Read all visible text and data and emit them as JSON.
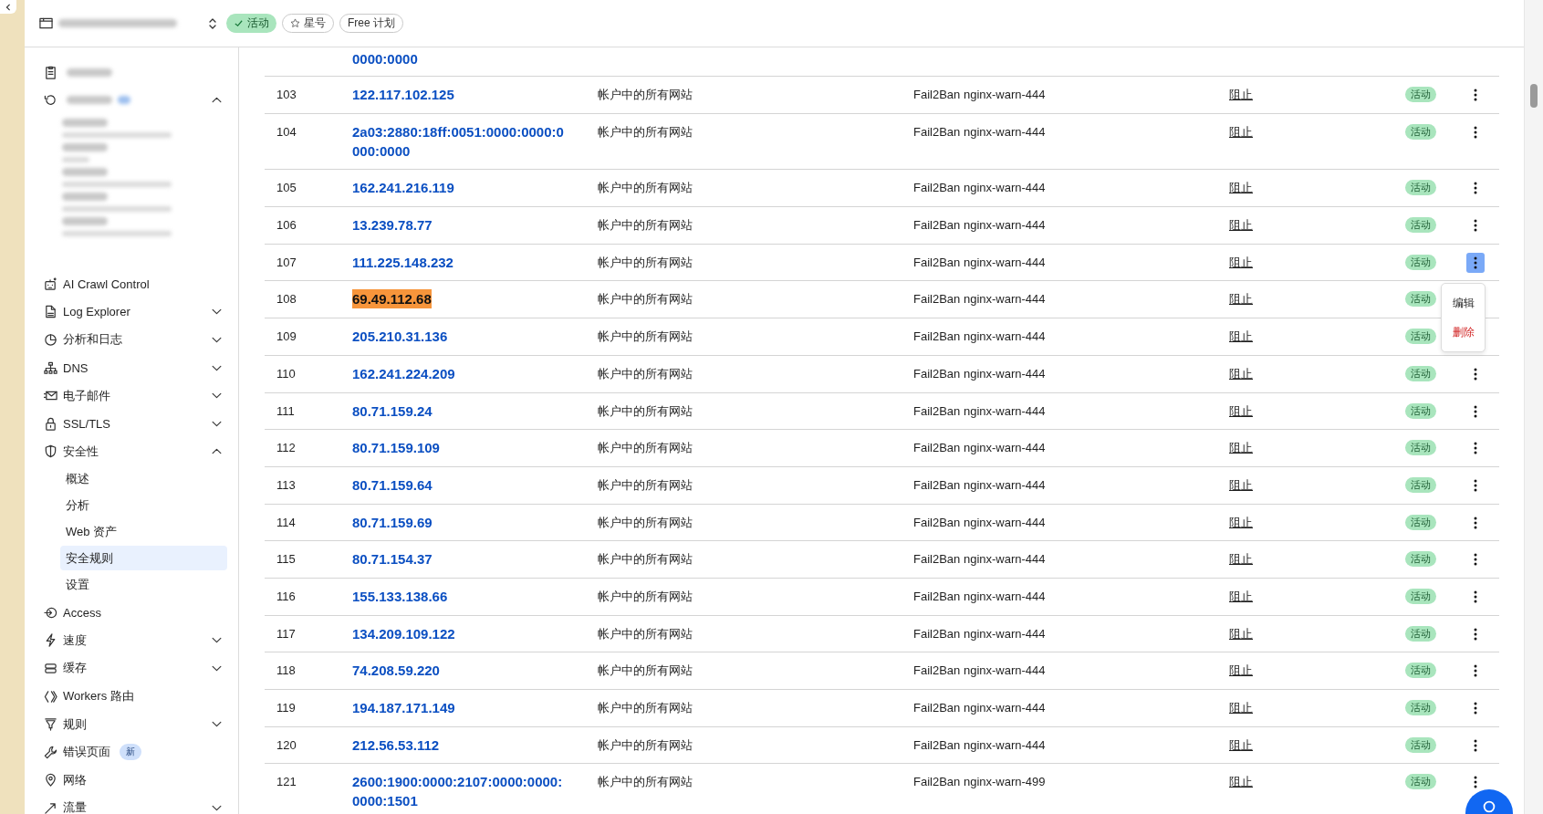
{
  "header": {
    "status_badge": "活动",
    "star_button": "星号",
    "plan_badge": "Free 计划"
  },
  "sidebar": {
    "redacted_section": {
      "expanded": true
    },
    "items": [
      {
        "label": "AI Crawl Control"
      },
      {
        "label": "Log Explorer",
        "expanded": false
      },
      {
        "label": "分析和日志",
        "expanded": false
      },
      {
        "label": "DNS",
        "expanded": false
      },
      {
        "label": "电子邮件",
        "expanded": false
      },
      {
        "label": "SSL/TLS",
        "expanded": false
      },
      {
        "label": "安全性",
        "expanded": true,
        "children": [
          {
            "label": "概述",
            "selected": false
          },
          {
            "label": "分析",
            "selected": false
          },
          {
            "label": "Web 资产",
            "selected": false
          },
          {
            "label": "安全规则",
            "selected": true
          },
          {
            "label": "设置",
            "selected": false
          }
        ]
      },
      {
        "label": "Access"
      },
      {
        "label": "速度",
        "expanded": false
      },
      {
        "label": "缓存",
        "expanded": false
      },
      {
        "label": "Workers 路由"
      },
      {
        "label": "规则",
        "expanded": false
      },
      {
        "label": "错误页面",
        "badge": "新"
      },
      {
        "label": "网络"
      },
      {
        "label": "流量",
        "expanded": false
      }
    ]
  },
  "table": {
    "rows": [
      {
        "ip": "0000:0000"
      },
      {
        "number": "103",
        "ip": "122.117.102.125",
        "scope": "帐户中的所有网站",
        "rule": "Fail2Ban nginx-warn-444",
        "action": "阻止",
        "status": "活动",
        "highlighted": false,
        "menu_open": false
      },
      {
        "number": "104",
        "ip": "2a03:2880:18ff:0051:0000:0000:0000:0000",
        "scope": "帐户中的所有网站",
        "rule": "Fail2Ban nginx-warn-444",
        "action": "阻止",
        "status": "活动",
        "highlighted": false,
        "menu_open": false
      },
      {
        "number": "105",
        "ip": "162.241.216.119",
        "scope": "帐户中的所有网站",
        "rule": "Fail2Ban nginx-warn-444",
        "action": "阻止",
        "status": "活动",
        "highlighted": false,
        "menu_open": false
      },
      {
        "number": "106",
        "ip": "13.239.78.77",
        "scope": "帐户中的所有网站",
        "rule": "Fail2Ban nginx-warn-444",
        "action": "阻止",
        "status": "活动",
        "highlighted": false,
        "menu_open": false
      },
      {
        "number": "107",
        "ip": "111.225.148.232",
        "scope": "帐户中的所有网站",
        "rule": "Fail2Ban nginx-warn-444",
        "action": "阻止",
        "status": "活动",
        "highlighted": false,
        "menu_open": true
      },
      {
        "number": "108",
        "ip": "69.49.112.68",
        "scope": "帐户中的所有网站",
        "rule": "Fail2Ban nginx-warn-444",
        "action": "阻止",
        "status": "活动",
        "highlighted": true
      },
      {
        "number": "109",
        "ip": "205.210.31.136",
        "scope": "帐户中的所有网站",
        "rule": "Fail2Ban nginx-warn-444",
        "action": "阻止",
        "status": "活动",
        "highlighted": false
      },
      {
        "number": "110",
        "ip": "162.241.224.209",
        "scope": "帐户中的所有网站",
        "rule": "Fail2Ban nginx-warn-444",
        "action": "阻止",
        "status": "活动",
        "highlighted": false,
        "menu_open": false
      },
      {
        "number": "111",
        "ip": "80.71.159.24",
        "scope": "帐户中的所有网站",
        "rule": "Fail2Ban nginx-warn-444",
        "action": "阻止",
        "status": "活动",
        "highlighted": false,
        "menu_open": false
      },
      {
        "number": "112",
        "ip": "80.71.159.109",
        "scope": "帐户中的所有网站",
        "rule": "Fail2Ban nginx-warn-444",
        "action": "阻止",
        "status": "活动",
        "highlighted": false,
        "menu_open": false
      },
      {
        "number": "113",
        "ip": "80.71.159.64",
        "scope": "帐户中的所有网站",
        "rule": "Fail2Ban nginx-warn-444",
        "action": "阻止",
        "status": "活动",
        "highlighted": false,
        "menu_open": false
      },
      {
        "number": "114",
        "ip": "80.71.159.69",
        "scope": "帐户中的所有网站",
        "rule": "Fail2Ban nginx-warn-444",
        "action": "阻止",
        "status": "活动",
        "highlighted": false,
        "menu_open": false
      },
      {
        "number": "115",
        "ip": "80.71.154.37",
        "scope": "帐户中的所有网站",
        "rule": "Fail2Ban nginx-warn-444",
        "action": "阻止",
        "status": "活动",
        "highlighted": false,
        "menu_open": false
      },
      {
        "number": "116",
        "ip": "155.133.138.66",
        "scope": "帐户中的所有网站",
        "rule": "Fail2Ban nginx-warn-444",
        "action": "阻止",
        "status": "活动",
        "highlighted": false,
        "menu_open": false
      },
      {
        "number": "117",
        "ip": "134.209.109.122",
        "scope": "帐户中的所有网站",
        "rule": "Fail2Ban nginx-warn-444",
        "action": "阻止",
        "status": "活动",
        "highlighted": false,
        "menu_open": false
      },
      {
        "number": "118",
        "ip": "74.208.59.220",
        "scope": "帐户中的所有网站",
        "rule": "Fail2Ban nginx-warn-444",
        "action": "阻止",
        "status": "活动",
        "highlighted": false,
        "menu_open": false
      },
      {
        "number": "119",
        "ip": "194.187.171.149",
        "scope": "帐户中的所有网站",
        "rule": "Fail2Ban nginx-warn-444",
        "action": "阻止",
        "status": "活动",
        "highlighted": false,
        "menu_open": false
      },
      {
        "number": "120",
        "ip": "212.56.53.112",
        "scope": "帐户中的所有网站",
        "rule": "Fail2Ban nginx-warn-444",
        "action": "阻止",
        "status": "活动",
        "highlighted": false,
        "menu_open": false
      },
      {
        "number": "121",
        "ip": "2600:1900:0000:2107:0000:0000:0000:1501",
        "scope": "帐户中的所有网站",
        "rule": "Fail2Ban nginx-warn-499",
        "action": "阻止",
        "status": "活动",
        "highlighted": false,
        "menu_open": false
      }
    ],
    "row_menu": [
      {
        "label": "编辑",
        "kind": "normal"
      },
      {
        "label": "删除",
        "kind": "danger"
      }
    ]
  }
}
